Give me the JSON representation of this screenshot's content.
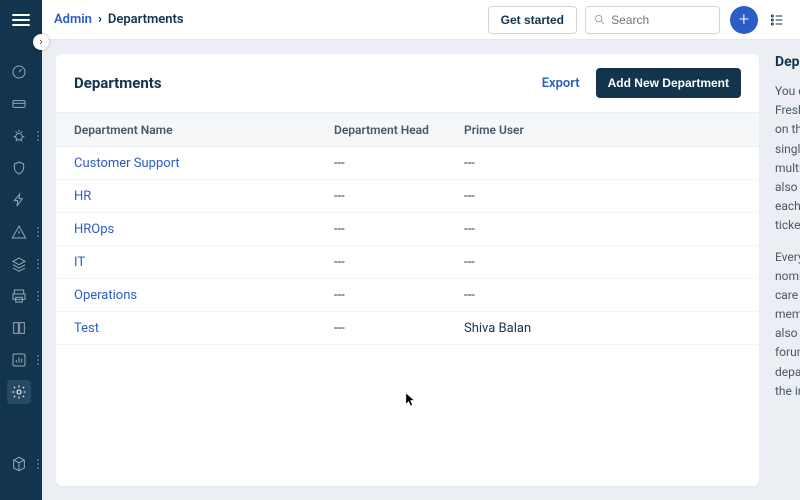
{
  "breadcrumb": {
    "root": "Admin",
    "current": "Departments"
  },
  "topbar": {
    "get_started": "Get started",
    "search_placeholder": "Search"
  },
  "card": {
    "title": "Departments",
    "export": "Export",
    "add_new": "Add New Department"
  },
  "table": {
    "headers": {
      "name": "Department Name",
      "head": "Department Head",
      "prime": "Prime User"
    },
    "rows": [
      {
        "name": "Customer Support",
        "head": "---",
        "prime": "---"
      },
      {
        "name": "HR",
        "head": "---",
        "prime": "---"
      },
      {
        "name": "HROps",
        "head": "---",
        "prime": "---"
      },
      {
        "name": "IT",
        "head": "---",
        "prime": "---"
      },
      {
        "name": "Operations",
        "head": "---",
        "prime": "---"
      },
      {
        "name": "Test",
        "head": "---",
        "prime": "Shiva Balan"
      }
    ]
  },
  "side": {
    "title": "Departments",
    "p1": "You can group your agents in Freshservice into Departments based on their functions or positions. A single department can address multiple types of problems. You can also assign different agents inside each one and define the visibility of tickets in the interface.",
    "p2": "Every department can have a nominated prime user who takes care of the tickets that department members may raise. Departments also control visibility of solution forum categories to specific departments, so end users see only the info they need."
  },
  "nav_icons": [
    "dashboard-icon",
    "ticket-icon",
    "bug-icon",
    "shield-icon",
    "bolt-icon",
    "alert-icon",
    "layers-icon",
    "print-icon",
    "book-icon",
    "chart-icon",
    "gear-icon"
  ],
  "nav_bottom_icon": "cube-icon"
}
